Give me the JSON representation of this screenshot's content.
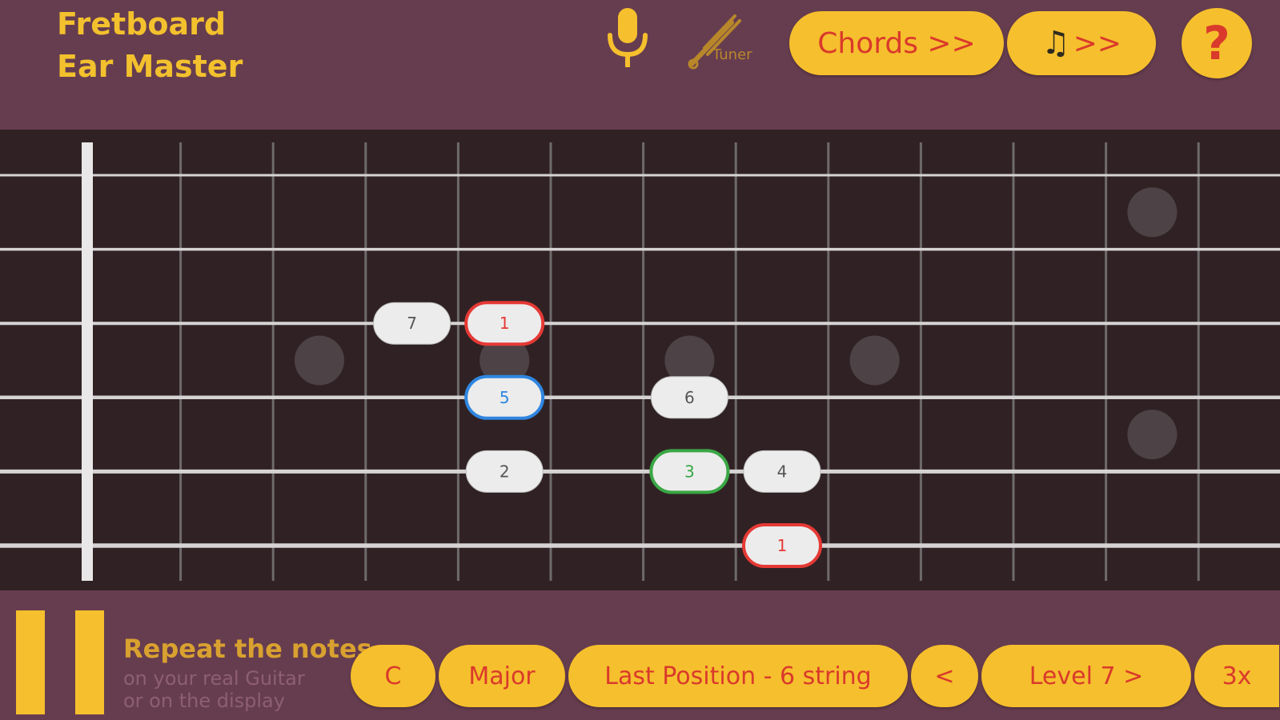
{
  "app": {
    "title_line1": "Fretboard",
    "title_line2": "Ear Master"
  },
  "header": {
    "mic_icon": "microphone-icon",
    "tuner": {
      "icon": "tuner-fork-icon",
      "label": "Tuner"
    },
    "chords_button": "Chords >>",
    "notes_button": {
      "glyph": "♫",
      "label": ">>"
    },
    "help_button": "?"
  },
  "fretboard": {
    "fret_count": 13,
    "string_count": 6,
    "inlay_markers": [
      {
        "fret": 3,
        "between_strings": [
          3,
          4
        ]
      },
      {
        "fret": 5,
        "between_strings": [
          3,
          4
        ]
      },
      {
        "fret": 7,
        "between_strings": [
          3,
          4
        ]
      },
      {
        "fret": 9,
        "between_strings": [
          3,
          4
        ]
      },
      {
        "fret": 12,
        "between_strings": [
          1,
          2
        ]
      },
      {
        "fret": 12,
        "between_strings": [
          4,
          5
        ]
      }
    ],
    "notes": [
      {
        "label": "7",
        "string": 3,
        "fret": 4,
        "style": "plain"
      },
      {
        "label": "1",
        "string": 3,
        "fret": 5,
        "style": "root"
      },
      {
        "label": "5",
        "string": 4,
        "fret": 5,
        "style": "fifth"
      },
      {
        "label": "6",
        "string": 4,
        "fret": 7,
        "style": "plain"
      },
      {
        "label": "2",
        "string": 5,
        "fret": 5,
        "style": "plain"
      },
      {
        "label": "3",
        "string": 5,
        "fret": 7,
        "style": "third"
      },
      {
        "label": "4",
        "string": 5,
        "fret": 8,
        "style": "plain"
      },
      {
        "label": "1",
        "string": 6,
        "fret": 8,
        "style": "root"
      }
    ],
    "colors": {
      "root": "#e53935",
      "fifth": "#2f86e0",
      "third": "#3aa745",
      "plain_text": "#555555"
    }
  },
  "footer": {
    "pause_icon": "pause-icon",
    "instruction": "Repeat the notes",
    "sub1": "on your real Guitar",
    "sub2": "or on the display",
    "key": "C",
    "scale": "Major",
    "position": "Last Position - 6 string",
    "prev": "<",
    "level": "Level 7 >",
    "repeat": "3x"
  }
}
